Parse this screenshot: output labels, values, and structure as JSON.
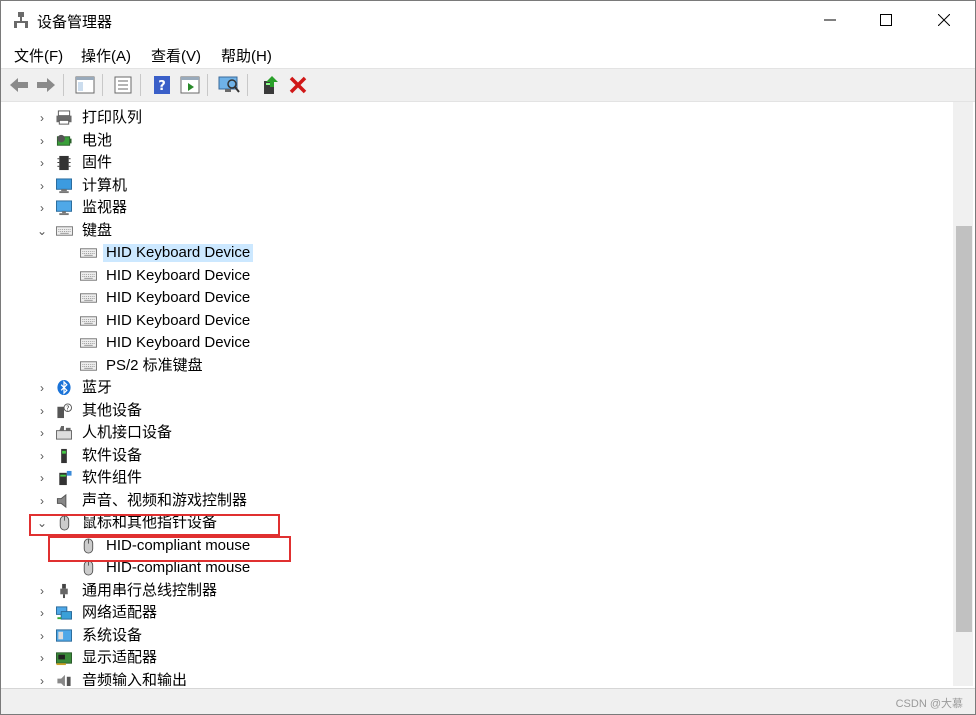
{
  "window": {
    "title": "设备管理器"
  },
  "menu": [
    {
      "label": "文件(F)"
    },
    {
      "label": "操作(A)"
    },
    {
      "label": "查看(V)"
    },
    {
      "label": "帮助(H)"
    }
  ],
  "toolbar_icons": [
    "back-icon",
    "forward-icon",
    "properties-pane-icon",
    "device-list-icon",
    "help-icon",
    "action-pane-icon",
    "scan-hardware-icon",
    "update-driver-icon",
    "uninstall-icon"
  ],
  "tree": [
    {
      "label": "打印队列",
      "expander": "›",
      "icon": "printer-icon"
    },
    {
      "label": "电池",
      "expander": "›",
      "icon": "battery-icon"
    },
    {
      "label": "固件",
      "expander": "›",
      "icon": "firmware-icon"
    },
    {
      "label": "计算机",
      "expander": "›",
      "icon": "computer-icon"
    },
    {
      "label": "监视器",
      "expander": "›",
      "icon": "monitor-icon"
    },
    {
      "label": "键盘",
      "expander": "⌄",
      "icon": "keyboard-icon"
    },
    {
      "label": "HID Keyboard Device",
      "icon": "keyboard-icon",
      "child": true,
      "selected": true
    },
    {
      "label": "HID Keyboard Device",
      "icon": "keyboard-icon",
      "child": true
    },
    {
      "label": "HID Keyboard Device",
      "icon": "keyboard-icon",
      "child": true
    },
    {
      "label": "HID Keyboard Device",
      "icon": "keyboard-icon",
      "child": true
    },
    {
      "label": "HID Keyboard Device",
      "icon": "keyboard-icon",
      "child": true
    },
    {
      "label": "PS/2 标准键盘",
      "icon": "keyboard-icon",
      "child": true
    },
    {
      "label": "蓝牙",
      "expander": "›",
      "icon": "bluetooth-icon"
    },
    {
      "label": "其他设备",
      "expander": "›",
      "icon": "other-device-icon"
    },
    {
      "label": "人机接口设备",
      "expander": "›",
      "icon": "hid-icon"
    },
    {
      "label": "软件设备",
      "expander": "›",
      "icon": "software-device-icon"
    },
    {
      "label": "软件组件",
      "expander": "›",
      "icon": "software-component-icon"
    },
    {
      "label": "声音、视频和游戏控制器",
      "expander": "›",
      "icon": "speaker-icon"
    },
    {
      "label": "鼠标和其他指针设备",
      "expander": "⌄",
      "icon": "mouse-icon"
    },
    {
      "label": "HID-compliant mouse",
      "icon": "mouse-icon",
      "child": true
    },
    {
      "label": "HID-compliant mouse",
      "icon": "mouse-icon",
      "child": true
    },
    {
      "label": "通用串行总线控制器",
      "expander": "›",
      "icon": "usb-icon"
    },
    {
      "label": "网络适配器",
      "expander": "›",
      "icon": "network-icon"
    },
    {
      "label": "系统设备",
      "expander": "›",
      "icon": "system-icon"
    },
    {
      "label": "显示适配器",
      "expander": "›",
      "icon": "display-adapter-icon"
    },
    {
      "label": "音频输入和输出",
      "expander": "›",
      "icon": "audio-io-icon"
    }
  ],
  "status": {
    "watermark": "CSDN @大慕"
  },
  "colors": {
    "selection": "#cce8ff",
    "highlight_box": "#e03030"
  }
}
